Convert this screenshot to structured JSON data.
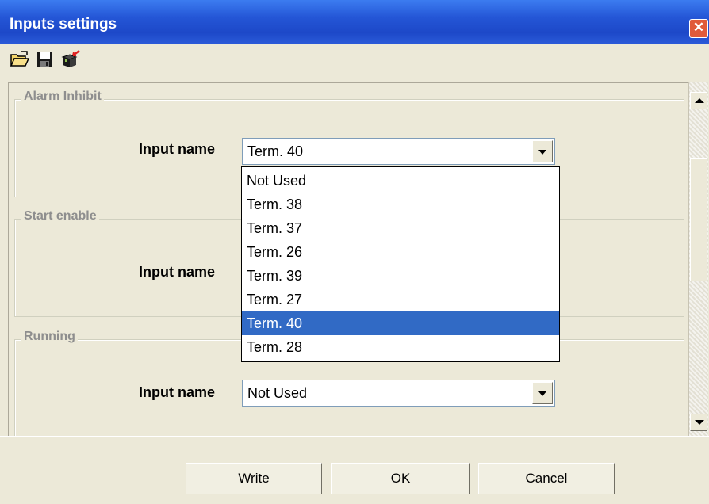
{
  "window": {
    "title": "Inputs settings"
  },
  "toolbar": {
    "icons": [
      "open-folder-icon",
      "save-floppy-icon",
      "export-box-icon"
    ]
  },
  "groups": [
    {
      "legend": "Alarm Inhibit",
      "input_label": "Input name",
      "value": "Term. 40"
    },
    {
      "legend": "Start enable",
      "input_label": "Input name",
      "value": ""
    },
    {
      "legend": "Running",
      "input_label": "Input name",
      "value": "Not Used"
    }
  ],
  "dropdown": {
    "options": [
      "Not Used",
      "Term. 38",
      "Term. 37",
      "Term. 26",
      "Term. 39",
      "Term. 27",
      "Term. 40",
      "Term. 28"
    ],
    "selected": "Term. 40"
  },
  "buttons": {
    "write": "Write",
    "ok": "OK",
    "cancel": "Cancel"
  },
  "colors": {
    "titlebar": "#2456d6",
    "selection": "#316ac5",
    "window_bg": "#ece9d8"
  }
}
